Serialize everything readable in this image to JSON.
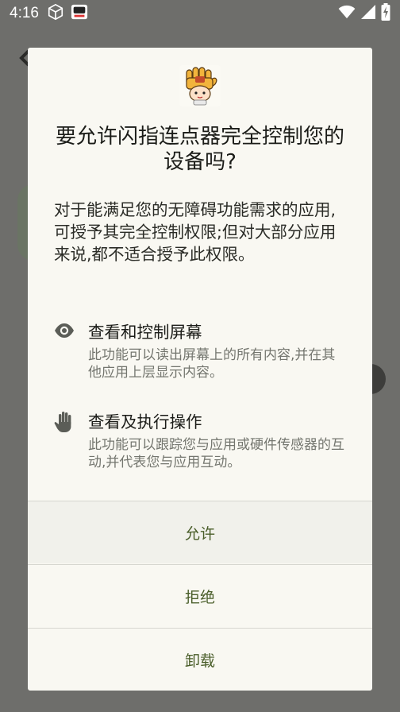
{
  "status_bar": {
    "time": "4:16",
    "left_icons": [
      "cube-icon",
      "app-notification-icon"
    ],
    "right_icons": [
      "wifi-icon",
      "signal-icon",
      "battery-charging-icon"
    ]
  },
  "dialog": {
    "app_icon": "app-mascot-icon",
    "title": "要允许闪指连点器完全控制您的设备吗?",
    "message": "对于能满足您的无障碍功能需求的应用,可授予其完全控制权限;但对大部分应用来说,都不适合授予此权限。",
    "permissions": [
      {
        "icon": "eye-icon",
        "title": "查看和控制屏幕",
        "description": "此功能可以读出屏幕上的所有内容,并在其他应用上层显示内容。"
      },
      {
        "icon": "hand-icon",
        "title": "查看及执行操作",
        "description": "此功能可以跟踪您与应用或硬件传感器的互动,并代表您与应用互动。"
      }
    ],
    "buttons": {
      "allow": "允许",
      "deny": "拒绝",
      "uninstall": "卸载"
    }
  },
  "colors": {
    "scrim": "#6e6e6b",
    "dialog_bg": "#f9f8f2",
    "button_text": "#4a5e2a",
    "secondary_text": "#74766f"
  }
}
